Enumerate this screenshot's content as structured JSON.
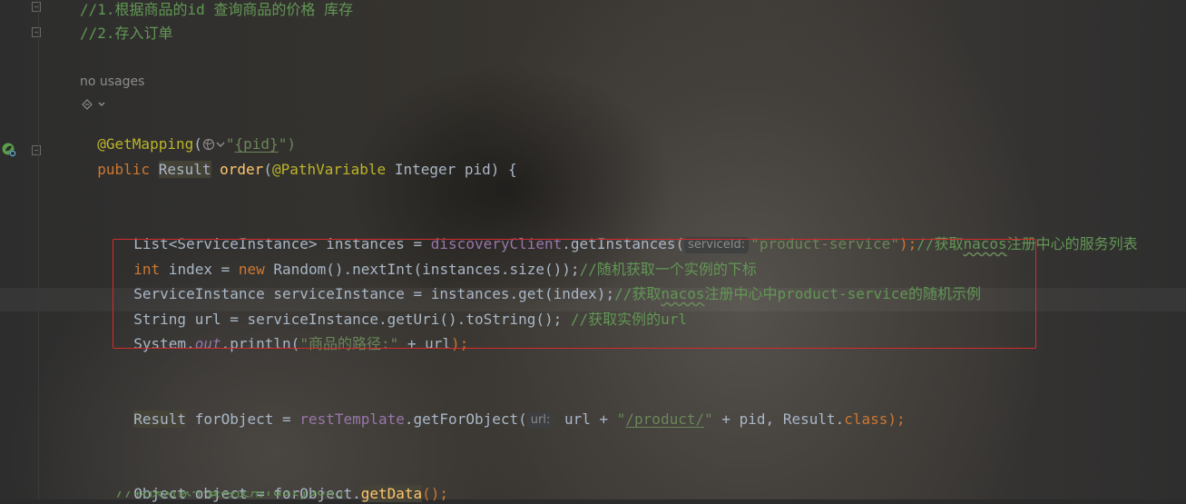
{
  "editor": {
    "comment_1": "//1.根据商品的id 查询商品的价格 库存",
    "comment_2": "//2.存入订单",
    "usages": "no usages",
    "annotation": {
      "name": "@GetMapping",
      "open": "(",
      "quote_open": "\"",
      "path": "{pid}",
      "close": "\")"
    },
    "signature": {
      "kw": "public",
      "type": "Result",
      "method": "order",
      "open": "(",
      "ann": "@PathVariable",
      "rest": " Integer pid) {"
    },
    "line_instances": {
      "decl": "List<ServiceInstance> instances = ",
      "field": "discoveryClient",
      "call": ".getInstances(",
      "hint": "serviceId:",
      "str": "\"product-service\"",
      "end": ");",
      "comment_pre": "//获取",
      "comment_nacos": "nacos",
      "comment_post": "注册中心的服务列表"
    },
    "line_index": {
      "kw": "int",
      "mid": " index = ",
      "kw_new": "new",
      "rest": " Random().nextInt(instances.size());",
      "comment": "//随机获取一个实例的下标"
    },
    "line_service_instance": {
      "code": "ServiceInstance serviceInstance = instances.get(index);",
      "comment_pre": "//获取",
      "comment_nacos": "nacos",
      "comment_post": "注册中心中product-service的随机示例"
    },
    "line_url": {
      "code": "String url = serviceInstance.getUri().toString();",
      "comment": " //获取实例的url"
    },
    "line_print": {
      "pre": "System.",
      "static_field": "out",
      "call": ".println(",
      "str": "\"商品的路径:\"",
      "rest": " + url",
      "end": ");"
    },
    "line_for_object": {
      "type": "Result",
      "decl": " forObject = ",
      "field": "restTemplate",
      "call": ".getForObject(",
      "hint": "url:",
      "arg1": " url + ",
      "str_q1": "\"",
      "str_path": "/product/",
      "str_q2": "\"",
      "rest": " + pid, Result.",
      "kw": "class",
      "end": ");"
    },
    "line_object": {
      "decl": "Object object = forObject.",
      "method": "getData",
      "end": "();"
    },
    "line_cut_comment": "//转换对象不要再使用fastjson了"
  },
  "colors": {
    "comment": "#629755",
    "keyword": "#cc7832",
    "string": "#6a8759",
    "field": "#9876aa",
    "method": "#ffc66d",
    "annotation": "#bbb529",
    "text": "#a9b7c6",
    "red_box": "#d52b2b"
  },
  "icons": [
    "fold-icon",
    "run-spring-icon",
    "globe-icon",
    "chevron-down-icon",
    "web-lens-icon"
  ]
}
